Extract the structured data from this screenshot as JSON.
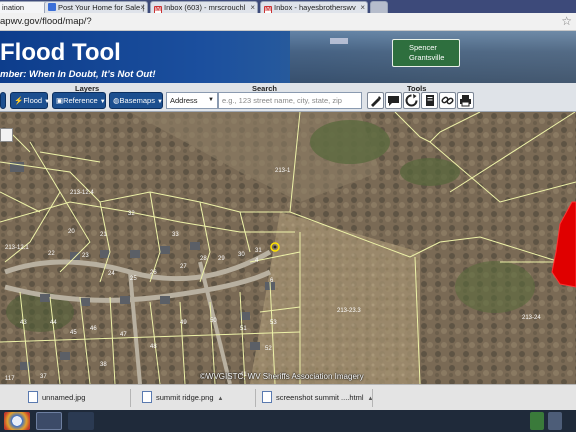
{
  "browser": {
    "tabs": [
      {
        "label": "ination",
        "icon": "page-icon",
        "active": true
      },
      {
        "label": "Post Your Home for Sale |",
        "icon": "home-icon",
        "active": false
      },
      {
        "label": "Inbox (603) - mrscrouchl",
        "icon": "gmail-icon",
        "active": false
      },
      {
        "label": "Inbox - hayesbrotherswv",
        "icon": "gmail-icon",
        "active": false
      }
    ],
    "url": "apwv.gov/flood/map/?"
  },
  "banner": {
    "title": "Flood Tool",
    "subtitle": "mber: When In Doubt, It’s Not Out!",
    "sign_lines": [
      "Spencer",
      "Grantsville"
    ]
  },
  "toolbar": {
    "layers_label": "Layers",
    "search_label": "Search",
    "tools_label": "Tools",
    "flood_btn": "Flood",
    "reference_btn": "Reference",
    "basemaps_btn": "Basemaps",
    "address_select": "Address",
    "search_placeholder": "e.g., 123 street name, city, state, zip"
  },
  "map": {
    "attribution": "©WVGISTC, WV Sheriffs Association Imagery",
    "parcel_labels": [
      "213-1",
      "213-12.1",
      "213-23.3",
      "213-24",
      "213-22",
      "32",
      "33",
      "20",
      "21",
      "22",
      "23",
      "24",
      "25",
      "26",
      "27",
      "28",
      "29",
      "30",
      "31",
      "10",
      "11",
      "12",
      "13",
      "14",
      "15",
      "16",
      "17",
      "18",
      "19",
      "8",
      "9",
      "6",
      "5",
      "4",
      "3",
      "2",
      "1",
      "43",
      "44",
      "45",
      "46",
      "47",
      "48",
      "49",
      "50",
      "51",
      "52",
      "53",
      "37",
      "38",
      "39",
      "40",
      "41",
      "42",
      "117",
      "24.1",
      "21.3"
    ],
    "flood_color": "#e00000"
  },
  "downloads": [
    {
      "name": "unnamed.jpg"
    },
    {
      "name": "summit ridge.png"
    },
    {
      "name": "screenshot summit ....html"
    }
  ]
}
